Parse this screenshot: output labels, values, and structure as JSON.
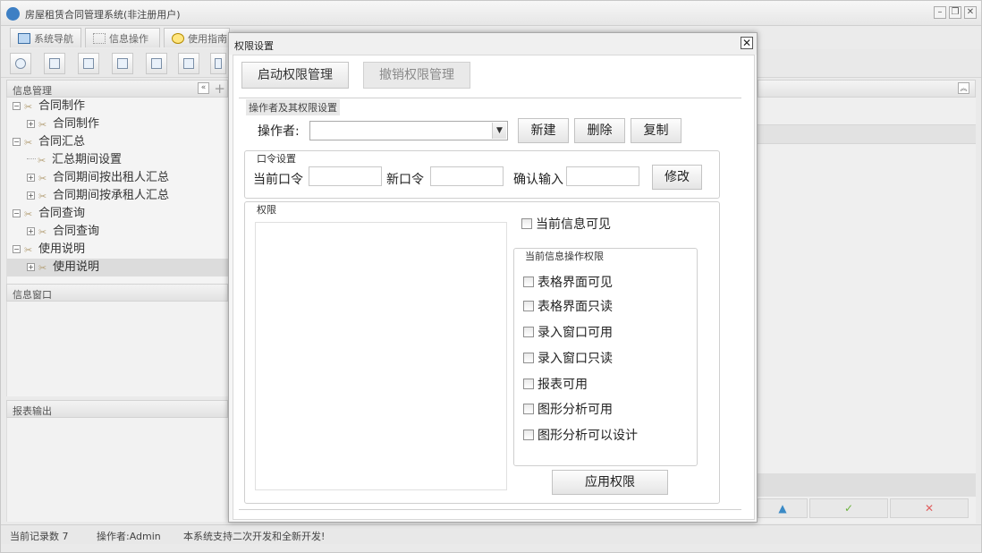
{
  "window": {
    "title": "房屋租赁合同管理系统(非注册用户)",
    "controls": [
      "minimize",
      "restore",
      "close"
    ]
  },
  "tabs": [
    {
      "label": "系统导航",
      "icon": "monitor-icon"
    },
    {
      "label": "信息操作",
      "icon": "grid-icon"
    },
    {
      "label": "使用指南",
      "icon": "lightbulb-icon"
    }
  ],
  "left_panel": {
    "header": "信息管理",
    "tree": [
      {
        "label": "合同制作",
        "level": 0,
        "expander": "minus"
      },
      {
        "label": "合同制作",
        "level": 1,
        "expander": "plus"
      },
      {
        "label": "合同汇总",
        "level": 0,
        "expander": "minus"
      },
      {
        "label": "汇总期间设置",
        "level": 1,
        "expander": "none"
      },
      {
        "label": "合同期间按出租人汇总",
        "level": 1,
        "expander": "plus"
      },
      {
        "label": "合同期间按承租人汇总",
        "level": 1,
        "expander": "plus"
      },
      {
        "label": "合同查询",
        "level": 0,
        "expander": "minus"
      },
      {
        "label": "合同查询",
        "level": 1,
        "expander": "plus"
      },
      {
        "label": "使用说明",
        "level": 0,
        "expander": "minus"
      },
      {
        "label": "使用说明",
        "level": 1,
        "expander": "plus",
        "selected": true
      }
    ],
    "info_window_header": "信息窗口",
    "report_output_header": "报表输出"
  },
  "right_pane": {
    "nav_icons": [
      "up-arrow-icon",
      "check-icon",
      "cancel-icon"
    ],
    "nav_glyphs": [
      "▲",
      "✓",
      "✕"
    ]
  },
  "status_bar": {
    "record_count": "当前记录数 7",
    "operator": "操作者:Admin",
    "message": "本系统支持二次开发和全新开发!"
  },
  "dialog": {
    "title": "权限设置",
    "start_button": "启动权限管理",
    "cancel_button": "撤销权限管理",
    "operator_section": {
      "legend": "操作者及其权限设置",
      "operator_label": "操作者:",
      "operator_value": "",
      "new_button": "新建",
      "delete_button": "删除",
      "copy_button": "复制"
    },
    "password_section": {
      "legend": "口令设置",
      "current_label": "当前口令",
      "new_label": "新口令",
      "confirm_label": "确认输入",
      "modify_button": "修改"
    },
    "permissions_section": {
      "legend": "权限",
      "visible_checkbox": "当前信息可见",
      "ops_legend": "当前信息操作权限",
      "checkboxes": [
        "表格界面可见",
        "表格界面只读",
        "录入窗口可用",
        "录入窗口只读",
        "报表可用",
        "图形分析可用",
        "图形分析可以设计"
      ],
      "apply_button": "应用权限"
    }
  }
}
